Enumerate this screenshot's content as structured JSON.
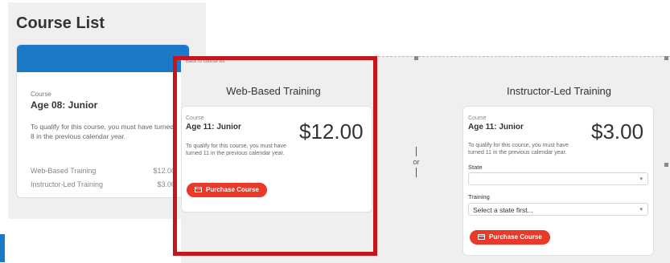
{
  "background_list": {
    "title": "Course List",
    "card": {
      "label": "Course",
      "name": "Age 08: Junior",
      "description": "To qualify for this course, you must have turned 8 in the previous calendar year.",
      "rows": [
        {
          "label": "Web-Based Training",
          "value": "$12.00"
        },
        {
          "label": "Instructor-Led Training",
          "value": "$3.00"
        }
      ]
    }
  },
  "overlay": {
    "breadcrumb_text": "Back to course list",
    "or_label": "or",
    "web_based": {
      "title": "Web-Based Training",
      "course_label": "Course",
      "course_name": "Age 11: Junior",
      "price": "$12.00",
      "description": "To qualify for this course, you must have turned 11 in the previous calendar year.",
      "button": "Purchase Course"
    },
    "instructor_led": {
      "title": "Instructor-Led Training",
      "course_label": "Course",
      "course_name": "Age 11: Junior",
      "price": "$3.00",
      "description": "To qualify for this course, you must have turned 11 in the previous calendar year.",
      "state_label": "State",
      "state_value": "",
      "training_label": "Training",
      "training_value": "Select a state first...",
      "button": "Purchase Course"
    }
  },
  "colors": {
    "accent_blue": "#1b79c7",
    "button_red": "#e8392a",
    "highlight_red": "#c4161c"
  }
}
